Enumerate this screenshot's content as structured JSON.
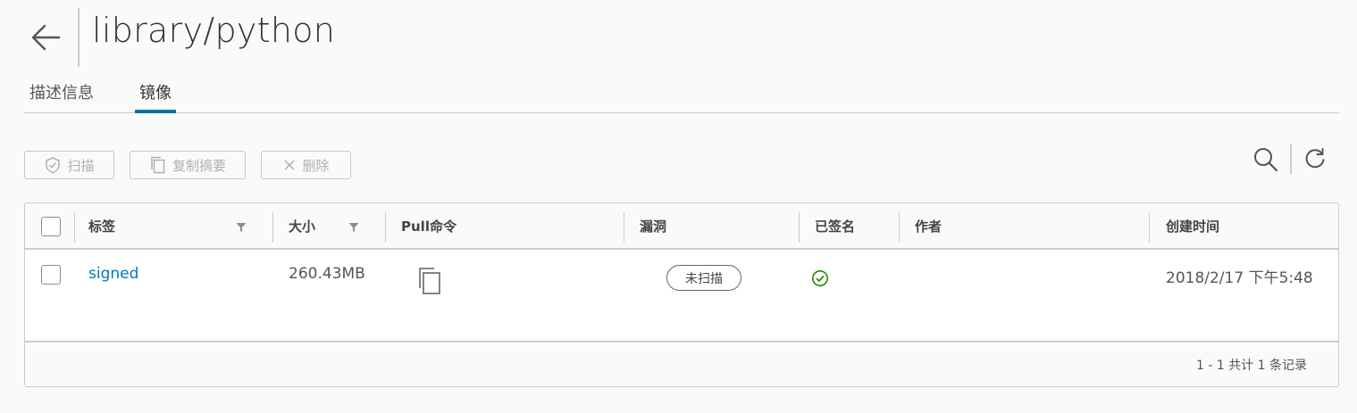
{
  "header": {
    "title": "library/python"
  },
  "tabs": [
    {
      "label": "描述信息"
    },
    {
      "label": "镜像"
    }
  ],
  "toolbar": {
    "scan_label": "扫描",
    "copy_digest_label": "复制摘要",
    "delete_label": "删除"
  },
  "table": {
    "columns": [
      "标签",
      "大小",
      "Pull命令",
      "漏洞",
      "已签名",
      "作者",
      "创建时间"
    ],
    "rows": [
      {
        "tag": "signed",
        "size": "260.43MB",
        "vulnerability": "未扫描",
        "signed": true,
        "author": "",
        "created": "2018/2/17 下午5:48"
      }
    ],
    "footer": "1 - 1 共计 1 条记录"
  },
  "colors": {
    "accent": "#0072a3",
    "link": "#0079b8",
    "signed_ok": "#2e8500"
  }
}
